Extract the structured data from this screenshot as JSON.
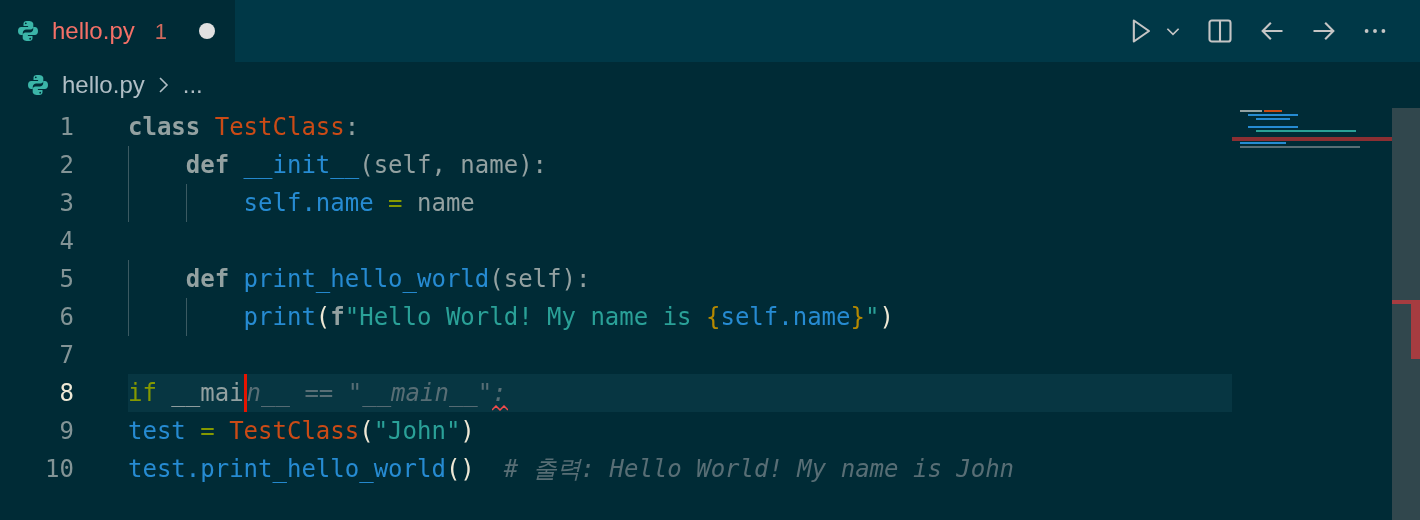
{
  "tab": {
    "title": "hello.py",
    "problems": "1",
    "dirty": true,
    "selected": true
  },
  "breadcrumbs": [
    "hello.py",
    "..."
  ],
  "lines": [
    {
      "number": "1",
      "current": false,
      "tokens": [
        {
          "kind": "keyword",
          "text": "class"
        },
        {
          "kind": "class",
          "text": " TestClass"
        },
        {
          "kind": "plain",
          "text": ":"
        }
      ]
    },
    {
      "number": "2",
      "current": false,
      "tokens": [
        {
          "kind": "keyword",
          "text": "    def"
        },
        {
          "kind": "func",
          "text": " __init__"
        },
        {
          "kind": "plain",
          "text": "(self, name):"
        }
      ]
    },
    {
      "number": "3",
      "current": false,
      "tokens": [
        {
          "kind": "func",
          "text": "        self.name"
        },
        {
          "kind": "op",
          "text": " ="
        },
        {
          "kind": "plain",
          "text": " name"
        }
      ]
    },
    {
      "number": "4",
      "current": false
    },
    {
      "number": "5",
      "current": false,
      "tokens": [
        {
          "kind": "keyword",
          "text": "    def"
        },
        {
          "kind": "func",
          "text": " print_hello_world"
        },
        {
          "kind": "plain",
          "text": "(self):"
        }
      ]
    },
    {
      "number": "6",
      "current": false,
      "tokens": [
        {
          "kind": "func",
          "text": "        print"
        },
        {
          "kind": "paren",
          "text": "("
        },
        {
          "kind": "keyword",
          "text": "f"
        },
        {
          "kind": "string",
          "text": "\"Hello World! My name is "
        },
        {
          "kind": "brace",
          "text": "{"
        },
        {
          "kind": "func",
          "text": "self.name"
        },
        {
          "kind": "brace",
          "text": "}"
        },
        {
          "kind": "string",
          "text": "\""
        },
        {
          "kind": "paren",
          "text": ")"
        }
      ]
    },
    {
      "number": "7",
      "current": false
    },
    {
      "number": "8",
      "current": true,
      "tokens": [
        {
          "kind": "op",
          "text": "if"
        },
        {
          "kind": "plain",
          "text": " __mai"
        },
        {
          "kind": "cursor"
        },
        {
          "kind": "ghost",
          "text": "n__ == \"__main__\""
        },
        {
          "kind": "ghost",
          "text": ":",
          "error": true
        }
      ]
    },
    {
      "number": "9",
      "current": false,
      "tokens": [
        {
          "kind": "func",
          "text": "test"
        },
        {
          "kind": "op",
          "text": " ="
        },
        {
          "kind": "class",
          "text": " TestClass"
        },
        {
          "kind": "paren",
          "text": "("
        },
        {
          "kind": "string",
          "text": "\"John\""
        },
        {
          "kind": "paren",
          "text": ")"
        }
      ]
    },
    {
      "number": "10",
      "current": false,
      "tokens": [
        {
          "kind": "func",
          "text": "test.print_hello_world"
        },
        {
          "kind": "paren",
          "text": "()"
        },
        {
          "kind": "comment",
          "text": "  # 출력: Hello World! My name is John"
        }
      ]
    }
  ]
}
